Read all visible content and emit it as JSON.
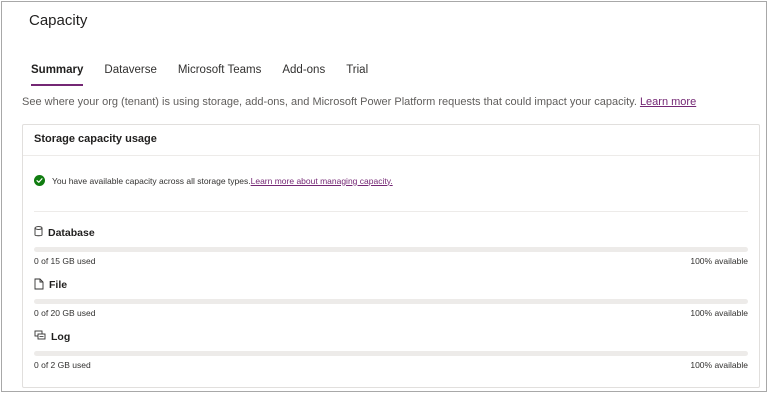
{
  "page": {
    "title": "Capacity"
  },
  "tabs": [
    {
      "label": "Summary",
      "active": true
    },
    {
      "label": "Dataverse",
      "active": false
    },
    {
      "label": "Microsoft Teams",
      "active": false
    },
    {
      "label": "Add-ons",
      "active": false
    },
    {
      "label": "Trial",
      "active": false
    }
  ],
  "description": {
    "text": "See where your org (tenant) is using storage, add-ons, and Microsoft Power Platform requests that could impact your capacity. ",
    "link": "Learn more"
  },
  "storage_card": {
    "title": "Storage capacity usage",
    "notice": {
      "text": "You have available capacity across all storage types. ",
      "link": "Learn more about managing capacity.",
      "icon": "checkmark-circle-icon"
    },
    "items": [
      {
        "name": "Database",
        "icon": "database-icon",
        "used": "0 of 15 GB used",
        "available": "100% available",
        "used_fraction": 0
      },
      {
        "name": "File",
        "icon": "file-icon",
        "used": "0 of 20 GB used",
        "available": "100% available",
        "used_fraction": 0
      },
      {
        "name": "Log",
        "icon": "log-icon",
        "used": "0 of 2 GB used",
        "available": "100% available",
        "used_fraction": 0
      }
    ]
  },
  "colors": {
    "accent": "#742774",
    "success": "#107c10",
    "track": "#edebe9"
  }
}
